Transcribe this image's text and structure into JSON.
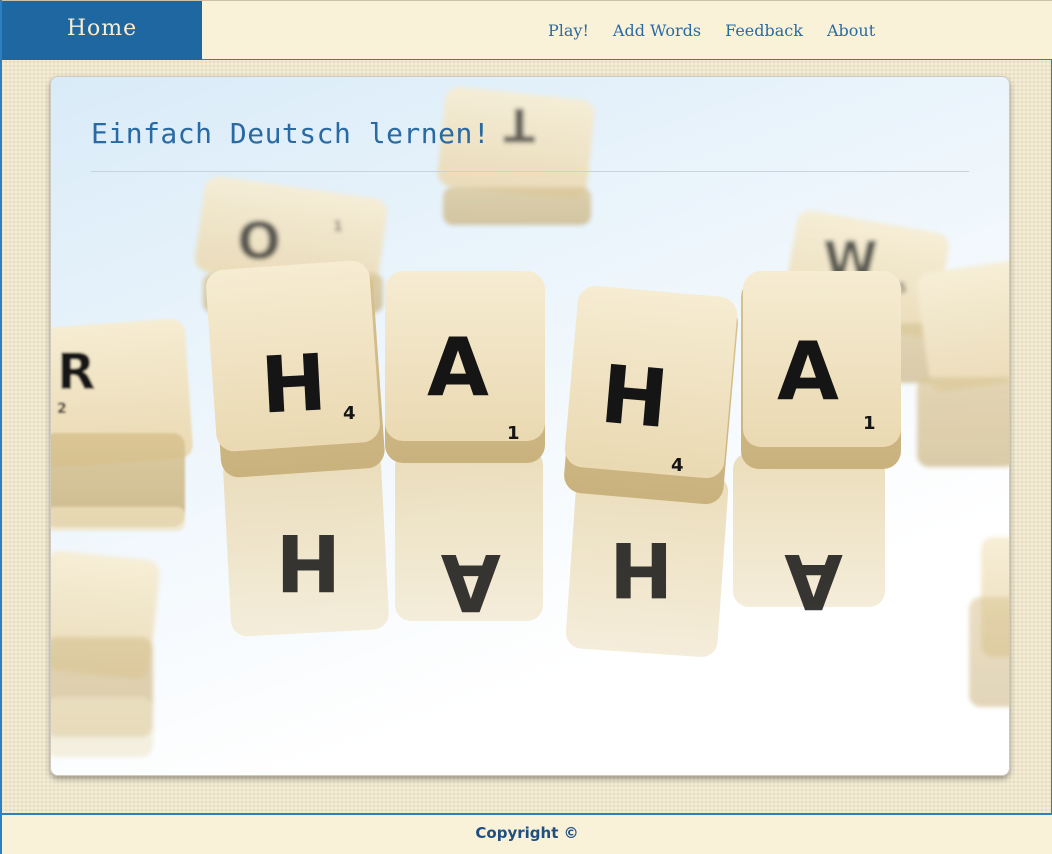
{
  "header": {
    "brand": "Home",
    "nav": [
      {
        "label": "Play!"
      },
      {
        "label": "Add Words"
      },
      {
        "label": "Feedback"
      },
      {
        "label": "About"
      }
    ]
  },
  "hero": {
    "title": "Einfach Deutsch lernen!",
    "image_description_tiles": {
      "main_letters": [
        "H",
        "A",
        "H",
        "A"
      ],
      "main_points": [
        "4",
        "1",
        "4",
        "1"
      ],
      "background_letters": [
        "O",
        "T",
        "W",
        "R"
      ],
      "background_points": [
        "1",
        "1",
        "5",
        "2"
      ]
    }
  },
  "footer": {
    "copyright": "Copyright ©"
  },
  "colors": {
    "brand_bg": "#1f67a0",
    "nav_text": "#2a6aa3",
    "header_bg": "#f9f2d9",
    "accent_border": "#2e7fbf",
    "title_text": "#2a6aa3",
    "footer_text": "#1f4f82"
  }
}
